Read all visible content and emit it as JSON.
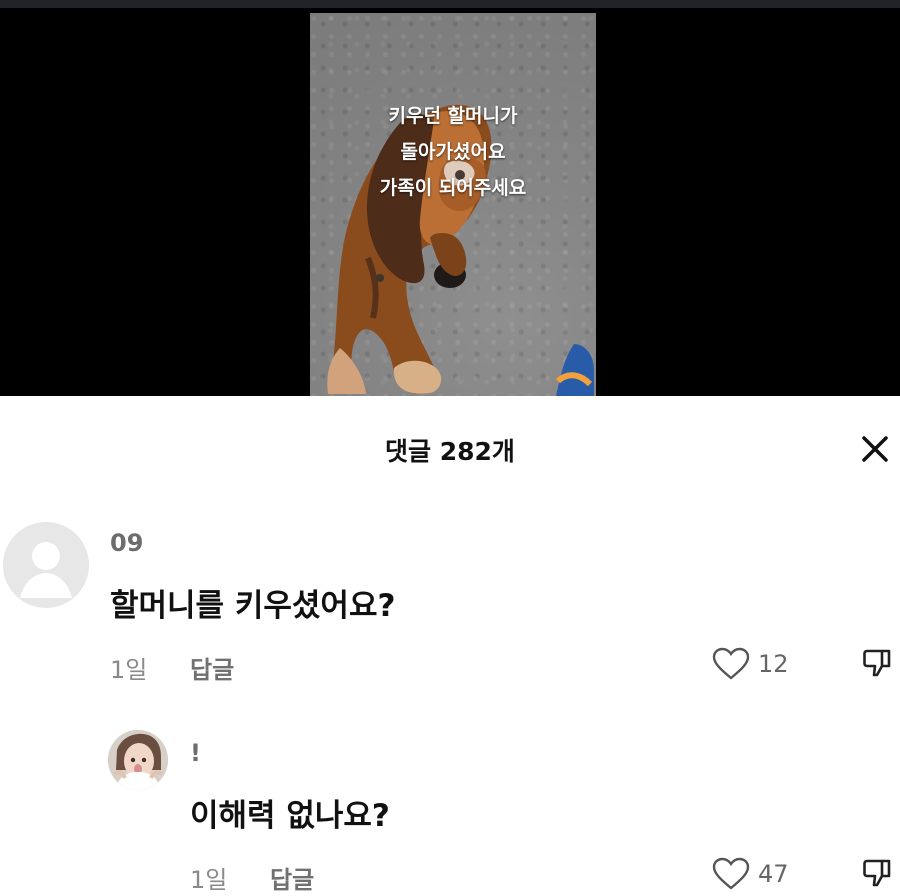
{
  "video": {
    "overlay_lines": [
      "키우던 할머니가",
      "돌아가셨어요",
      "가족이 되어주세요"
    ]
  },
  "comments_header": {
    "count_label": "댓글 282개"
  },
  "comments": [
    {
      "username": "09",
      "text": "할머니를 키우셨어요?",
      "time": "1일",
      "reply_label": "답글",
      "likes": "12"
    },
    {
      "username": "!",
      "text": "이해력 없나요?",
      "time": "1일",
      "reply_label": "답글",
      "likes": "47"
    }
  ],
  "icons": {
    "close": "close-icon",
    "like": "heart-icon",
    "dislike": "thumbs-down-icon",
    "default_avatar": "user-avatar-icon"
  },
  "colors": {
    "background": "#ffffff",
    "video_background": "#000000",
    "text_primary": "#111111",
    "text_secondary": "#707070",
    "avatar_placeholder": "#e7e7e7"
  }
}
